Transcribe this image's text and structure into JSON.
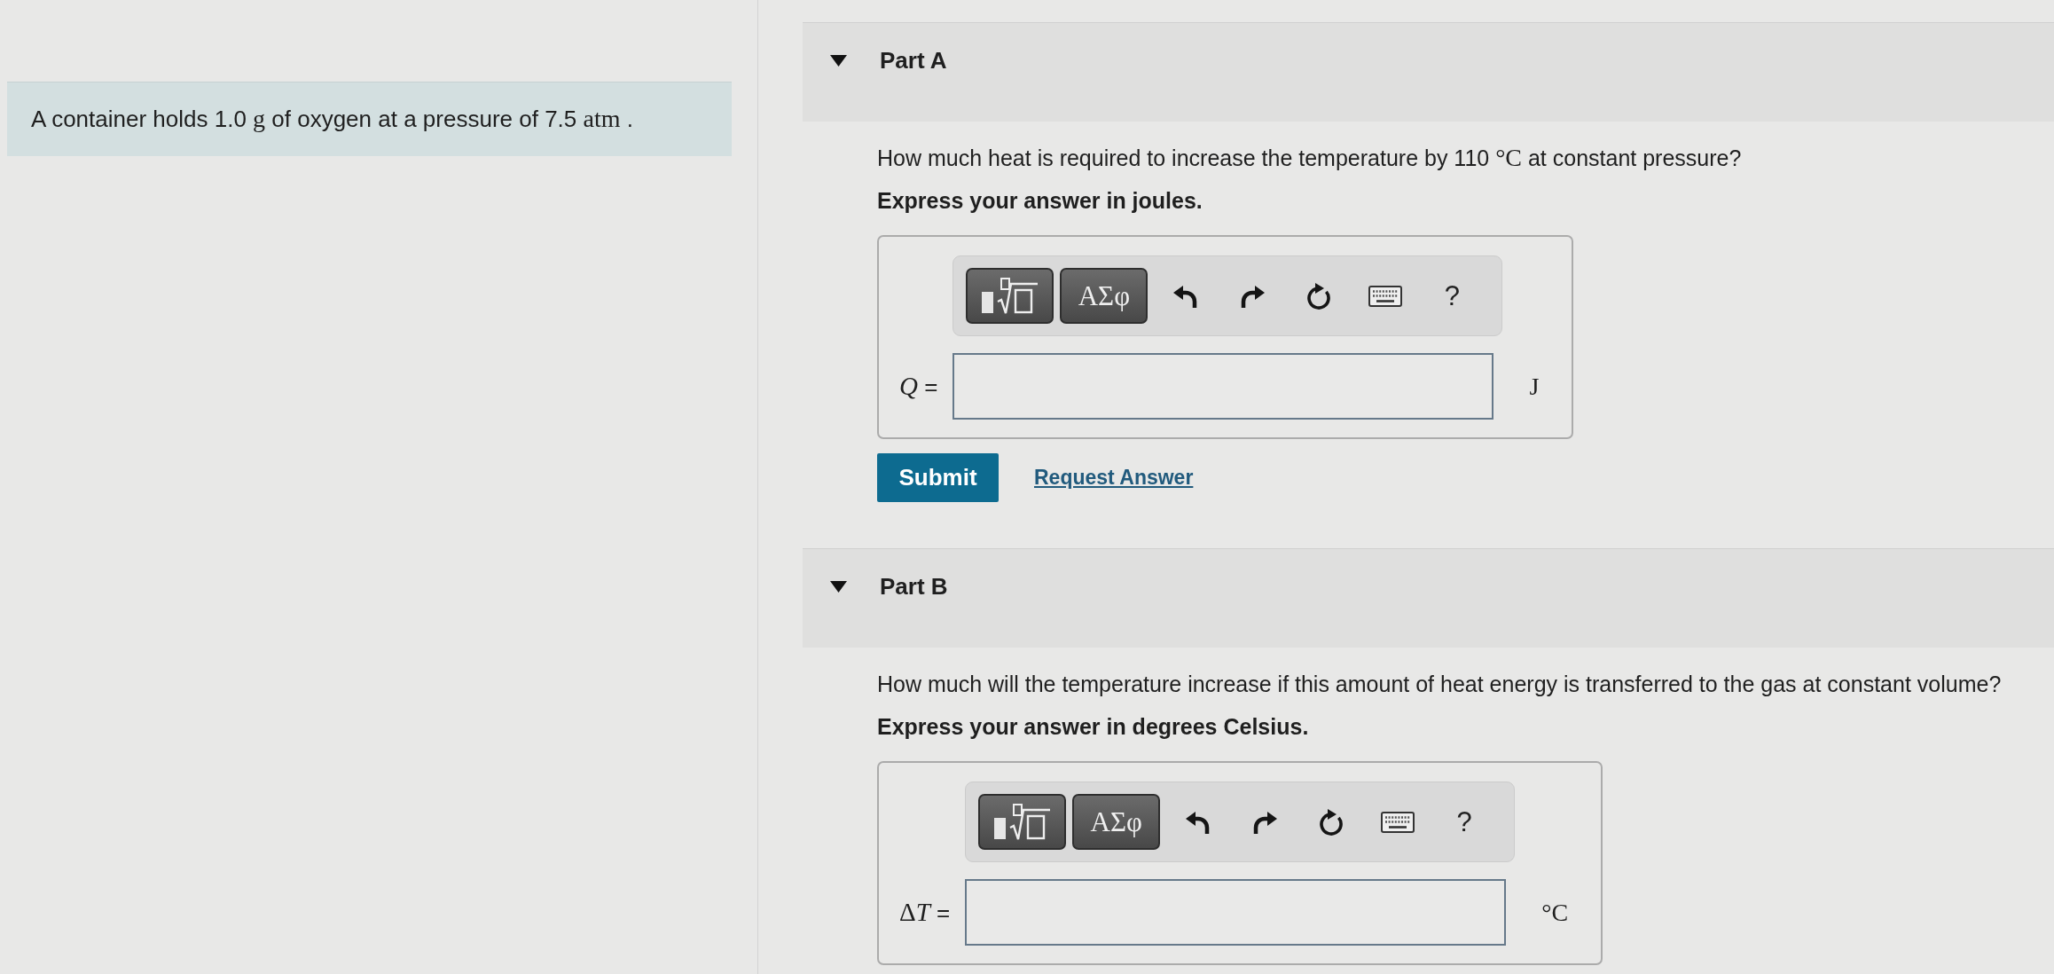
{
  "problem": {
    "segments": [
      {
        "kind": "text",
        "text": "A container holds 1.0 "
      },
      {
        "kind": "math",
        "text": "g"
      },
      {
        "kind": "text",
        "text": " of oxygen at a pressure of 7.5 "
      },
      {
        "kind": "math",
        "text": "atm"
      },
      {
        "kind": "text",
        "text": " ."
      }
    ]
  },
  "parts": [
    {
      "title": "Part A",
      "expanded": true,
      "question": [
        {
          "kind": "text",
          "text": "How much heat is required to increase the temperature by 110 "
        },
        {
          "kind": "math",
          "text": "°C"
        },
        {
          "kind": "text",
          "text": " at constant pressure?"
        }
      ],
      "instruction": "Express your answer in joules.",
      "toolbar": [
        {
          "kind": "template"
        },
        {
          "kind": "symbols",
          "label": "ΑΣφ"
        },
        {
          "kind": "undo"
        },
        {
          "kind": "redo"
        },
        {
          "kind": "reset"
        },
        {
          "kind": "keyboard"
        },
        {
          "kind": "help",
          "label": "?"
        }
      ],
      "answer": {
        "label": [
          {
            "kind": "var",
            "text": "Q"
          },
          {
            "kind": "text",
            "text": " ="
          }
        ],
        "unit": "J"
      },
      "actions": [
        {
          "kind": "submit",
          "label": "Submit"
        },
        {
          "kind": "link",
          "label": "Request Answer"
        }
      ]
    },
    {
      "title": "Part B",
      "expanded": true,
      "question": [
        {
          "kind": "text",
          "text": "How much will the temperature increase if this amount of heat energy is transferred to the gas at constant volume?"
        }
      ],
      "instruction": "Express your answer in degrees Celsius.",
      "toolbar": [
        {
          "kind": "template"
        },
        {
          "kind": "symbols",
          "label": "ΑΣφ"
        },
        {
          "kind": "undo"
        },
        {
          "kind": "redo"
        },
        {
          "kind": "reset"
        },
        {
          "kind": "keyboard"
        },
        {
          "kind": "help",
          "label": "?"
        }
      ],
      "answer": {
        "label": [
          {
            "kind": "math",
            "text": "Δ"
          },
          {
            "kind": "var",
            "text": "T"
          },
          {
            "kind": "text",
            "text": " ="
          }
        ],
        "unit": "°C"
      }
    }
  ]
}
